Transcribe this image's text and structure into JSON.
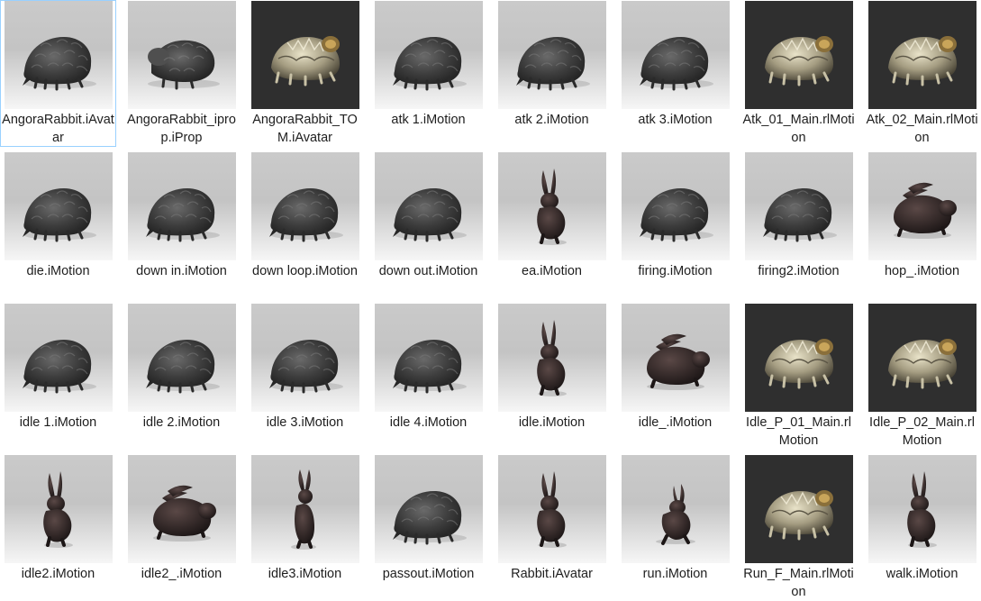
{
  "files": [
    {
      "name": "AngoraRabbit.iAvatar",
      "thumb": "angora",
      "selected": true
    },
    {
      "name": "AngoraRabbit_iprop.iProp",
      "thumb": "angora-side"
    },
    {
      "name": "AngoraRabbit_TOM.iAvatar",
      "thumb": "tom"
    },
    {
      "name": "atk 1.iMotion",
      "thumb": "angora"
    },
    {
      "name": "atk 2.iMotion",
      "thumb": "angora"
    },
    {
      "name": "atk 3.iMotion",
      "thumb": "angora"
    },
    {
      "name": "Atk_01_Main.rlMotion",
      "thumb": "tom"
    },
    {
      "name": "Atk_02_Main.rlMotion",
      "thumb": "tom"
    },
    {
      "name": "die.iMotion",
      "thumb": "angora"
    },
    {
      "name": "down in.iMotion",
      "thumb": "angora"
    },
    {
      "name": "down loop.iMotion",
      "thumb": "angora"
    },
    {
      "name": "down out.iMotion",
      "thumb": "angora"
    },
    {
      "name": "ea.iMotion",
      "thumb": "rabbit-stand"
    },
    {
      "name": "firing.iMotion",
      "thumb": "angora"
    },
    {
      "name": "firing2.iMotion",
      "thumb": "angora"
    },
    {
      "name": "hop_.iMotion",
      "thumb": "rabbit-crouch"
    },
    {
      "name": "idle 1.iMotion",
      "thumb": "angora"
    },
    {
      "name": "idle 2.iMotion",
      "thumb": "angora"
    },
    {
      "name": "idle 3.iMotion",
      "thumb": "angora"
    },
    {
      "name": "idle 4.iMotion",
      "thumb": "angora"
    },
    {
      "name": "idle.iMotion",
      "thumb": "rabbit-stand"
    },
    {
      "name": "idle_.iMotion",
      "thumb": "rabbit-crouch"
    },
    {
      "name": "Idle_P_01_Main.rlMotion",
      "thumb": "tom"
    },
    {
      "name": "Idle_P_02_Main.rlMotion",
      "thumb": "tom"
    },
    {
      "name": "idle2.iMotion",
      "thumb": "rabbit-stand"
    },
    {
      "name": "idle2_.iMotion",
      "thumb": "rabbit-crouch"
    },
    {
      "name": "idle3.iMotion",
      "thumb": "rabbit-upright"
    },
    {
      "name": "passout.iMotion",
      "thumb": "angora"
    },
    {
      "name": "Rabbit.iAvatar",
      "thumb": "rabbit-stand"
    },
    {
      "name": "run.iMotion",
      "thumb": "rabbit-run"
    },
    {
      "name": "Run_F_Main.rlMotion",
      "thumb": "tom"
    },
    {
      "name": "walk.iMotion",
      "thumb": "rabbit-stand"
    }
  ],
  "colors": {
    "selection_border": "#99d1ff",
    "dark_thumb_bg": "#2f2f2f",
    "text": "#1e1e1e"
  }
}
